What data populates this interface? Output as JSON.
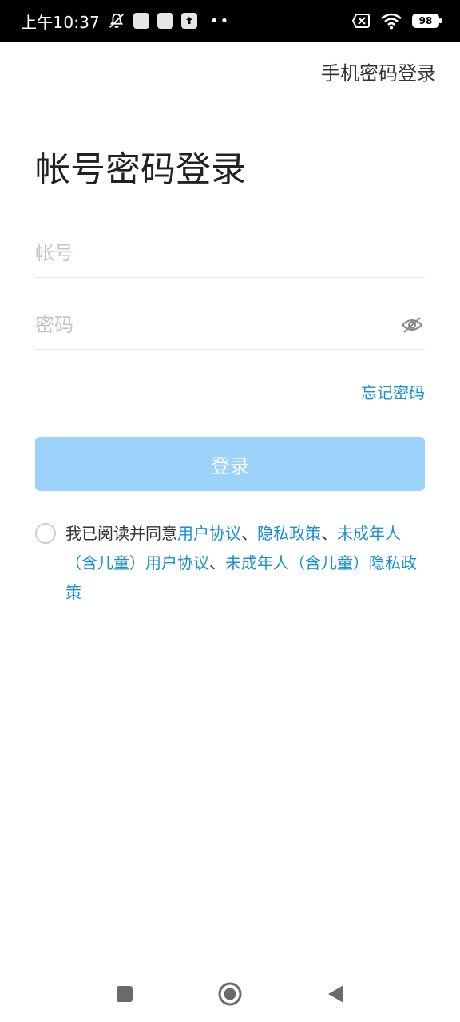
{
  "status_bar": {
    "time": "上午10:37",
    "battery": "98",
    "icons": [
      "mute-bell-icon",
      "notification-square-icon",
      "notification-square-icon",
      "upload-icon",
      "more-dots-icon",
      "sim-x-icon",
      "wifi-icon",
      "battery-icon"
    ]
  },
  "header": {
    "switch_login_label": "手机密码登录"
  },
  "page": {
    "title": "帐号密码登录"
  },
  "form": {
    "account_placeholder": "帐号",
    "account_value": "",
    "password_placeholder": "密码",
    "password_value": "",
    "password_toggle_icon": "eye-off-icon",
    "forgot_label": "忘记密码",
    "login_label": "登录"
  },
  "agreement": {
    "prefix": "我已阅读并同意",
    "link1": "用户协议",
    "sep1": "、",
    "link2": "隐私政策",
    "sep2": "、",
    "link3": "未成年人（含儿童）用户协议",
    "sep3": "、",
    "link4": "未成年人（含儿童）隐私政策"
  },
  "colors": {
    "accent": "#1a8fd6",
    "button_disabled": "#9dd3fb",
    "status_bar": "#000000"
  },
  "nav_bar": {
    "icons": [
      "square-recents-icon",
      "circle-home-icon",
      "triangle-back-icon"
    ]
  }
}
